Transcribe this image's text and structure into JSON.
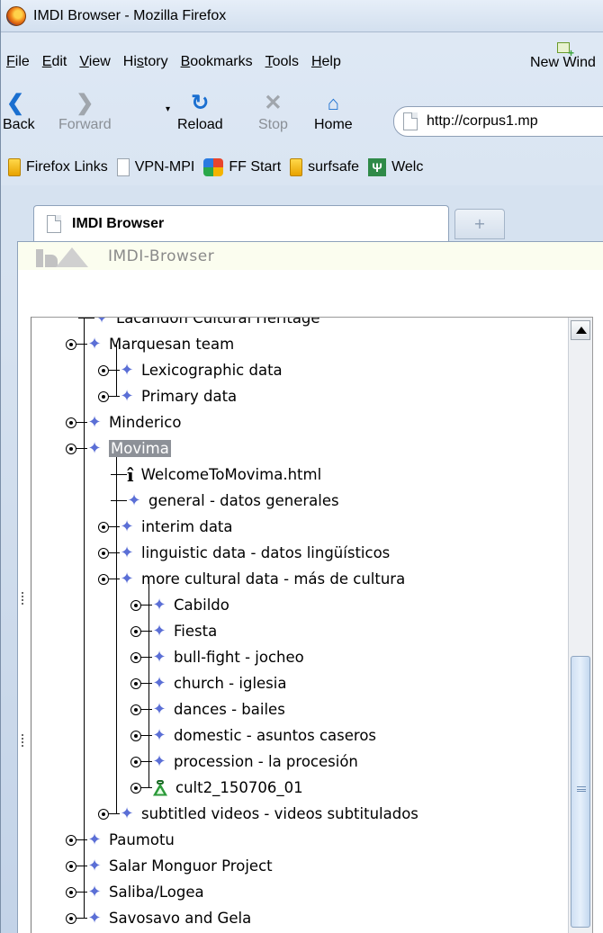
{
  "window": {
    "title": "IMDI Browser - Mozilla Firefox"
  },
  "menu": {
    "items": [
      {
        "label": "File",
        "mnemonic": "F",
        "rest": "ile"
      },
      {
        "label": "Edit",
        "mnemonic": "E",
        "rest": "dit"
      },
      {
        "label": "View",
        "mnemonic": "V",
        "rest": "iew"
      },
      {
        "label": "History",
        "mnemonic": "s",
        "pre": "Hi",
        "rest": "tory"
      },
      {
        "label": "Bookmarks",
        "mnemonic": "B",
        "rest": "ookmarks"
      },
      {
        "label": "Tools",
        "mnemonic": "T",
        "rest": "ools"
      },
      {
        "label": "Help",
        "mnemonic": "H",
        "rest": "elp"
      }
    ],
    "new_window": "New Wind"
  },
  "nav": {
    "back": "Back",
    "forward": "Forward",
    "reload": "Reload",
    "stop": "Stop",
    "home": "Home",
    "url": "http://corpus1.mp"
  },
  "bookmarks": [
    {
      "label": "Firefox Links",
      "icon": "folder-icon"
    },
    {
      "label": "VPN-MPI",
      "icon": "page-icon"
    },
    {
      "label": "FF Start",
      "icon": "ffstart-icon"
    },
    {
      "label": "surfsafe",
      "icon": "folder-icon"
    },
    {
      "label": "Welc",
      "icon": "psi-icon"
    }
  ],
  "tab": {
    "title": "IMDI Browser",
    "new_tab_symbol": "+"
  },
  "app": {
    "title": "IMDI-Browser"
  },
  "tree": {
    "nodes": [
      {
        "label": "Lacandon Cultural Heritage",
        "icon": "corpus-star-icon"
      },
      {
        "label": "Marquesan team",
        "icon": "corpus-star-icon"
      },
      {
        "label": "Lexicographic data",
        "icon": "corpus-star-icon"
      },
      {
        "label": "Primary data",
        "icon": "corpus-star-icon"
      },
      {
        "label": "Minderico",
        "icon": "corpus-star-icon"
      },
      {
        "label": "Movima",
        "icon": "corpus-star-icon",
        "selected": true
      },
      {
        "label": "WelcomeToMovima.html",
        "icon": "info-document-icon"
      },
      {
        "label": "general - datos generales",
        "icon": "corpus-star-icon"
      },
      {
        "label": "interim data",
        "icon": "corpus-star-icon"
      },
      {
        "label": "linguistic data - datos lingüísticos",
        "icon": "corpus-star-icon"
      },
      {
        "label": "more cultural data - más de cultura",
        "icon": "corpus-star-icon"
      },
      {
        "label": "Cabildo",
        "icon": "corpus-star-icon"
      },
      {
        "label": "Fiesta",
        "icon": "corpus-star-icon"
      },
      {
        "label": "bull-fight - jocheo",
        "icon": "corpus-star-icon"
      },
      {
        "label": "church - iglesia",
        "icon": "corpus-star-icon"
      },
      {
        "label": "dances - bailes",
        "icon": "corpus-star-icon"
      },
      {
        "label": "domestic - asuntos caseros",
        "icon": "corpus-star-icon"
      },
      {
        "label": "procession - la procesión",
        "icon": "corpus-star-icon"
      },
      {
        "label": "cult2_150706_01",
        "icon": "session-icon"
      },
      {
        "label": "subtitled videos - videos subtitulados",
        "icon": "corpus-star-icon"
      },
      {
        "label": "Paumotu",
        "icon": "corpus-star-icon"
      },
      {
        "label": "Salar Monguor Project",
        "icon": "corpus-star-icon"
      },
      {
        "label": "Saliba/Logea",
        "icon": "corpus-star-icon"
      },
      {
        "label": "Savosavo and Gela",
        "icon": "corpus-star-icon"
      }
    ]
  },
  "colors": {
    "corpus_star": "#5b6fd6",
    "selection": "#8d9198",
    "session_icon": "#2c9a3a"
  }
}
